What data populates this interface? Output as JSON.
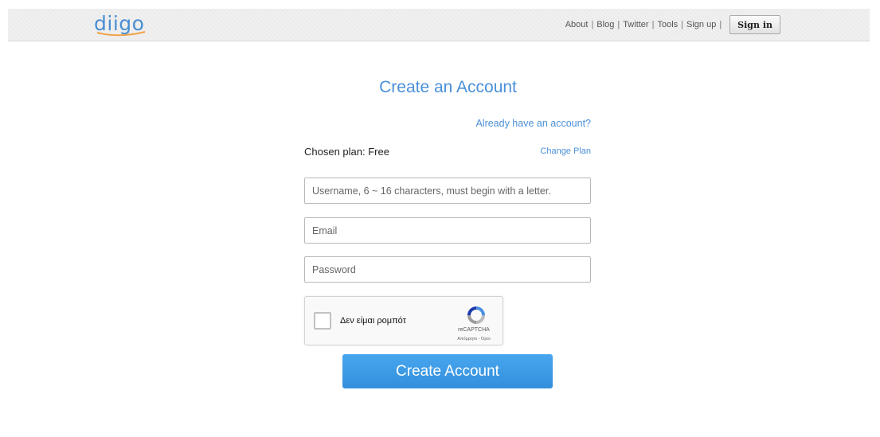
{
  "header": {
    "logo_text": "diigo",
    "nav": [
      {
        "label": "About"
      },
      {
        "label": "Blog"
      },
      {
        "label": "Twitter"
      },
      {
        "label": "Tools"
      },
      {
        "label": "Sign up"
      }
    ],
    "signin_label": "Sign in"
  },
  "form": {
    "title": "Create an Account",
    "already_link": "Already have an account?",
    "chosen_plan": "Chosen plan: Free",
    "change_plan": "Change Plan",
    "username": {
      "value": "",
      "placeholder": "Username, 6 ~ 16 characters, must begin with a letter."
    },
    "email": {
      "value": "",
      "placeholder": "Email"
    },
    "password": {
      "value": "",
      "placeholder": "Password"
    },
    "captcha": {
      "label": "Δεν είμαι ρομπότ",
      "brand": "reCAPTCHA",
      "links": "Απόρρητο - Όροι",
      "checked": false
    },
    "submit_label": "Create Account"
  },
  "colors": {
    "accent": "#4a90d9",
    "button": "#3d9be8",
    "topbar": "#ececec"
  }
}
